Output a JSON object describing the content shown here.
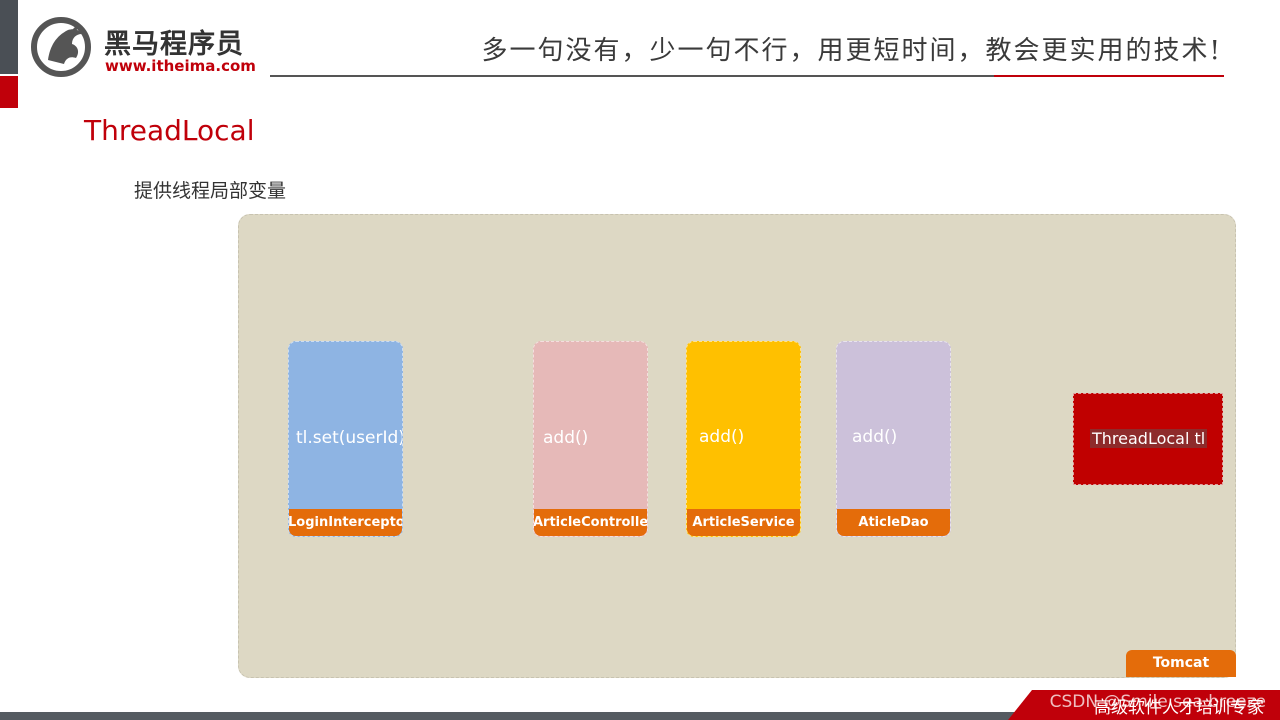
{
  "header": {
    "logo_cn": "黑马程序员",
    "logo_url": "www.itheima.com",
    "slogan": "多一句没有，少一句不行，用更短时间，教会更实用的技术!"
  },
  "slide": {
    "title": "ThreadLocal",
    "subtitle": "提供线程局部变量"
  },
  "diagram": {
    "container_label": "Tomcat",
    "components": [
      {
        "method": "tl.set(userId)",
        "label": "LoginInterceptor",
        "color": "#8eb4e3"
      },
      {
        "method": "add()",
        "label": "ArticleController",
        "color": "#e6b9b8"
      },
      {
        "method": "add()",
        "label": "ArticleService",
        "color": "#ffc000"
      },
      {
        "method": "add()",
        "label": "AticleDao",
        "color": "#ccc1da"
      }
    ],
    "threadlocal": {
      "label": "ThreadLocal  tl",
      "color": "#c00000"
    },
    "tag_color": "#e46c0a"
  },
  "footer": {
    "text": "高级软件人才培训专家",
    "watermark": "CSDN @Smile sea breeze"
  },
  "colors": {
    "brand_red": "#c0000a",
    "container_bg": "#ddd8c4"
  }
}
